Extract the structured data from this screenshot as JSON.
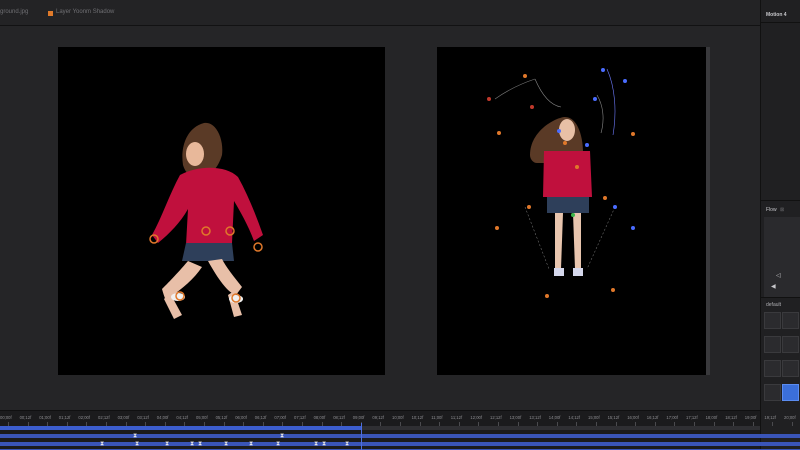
{
  "tabs": [
    {
      "label": "ground.jpg"
    },
    {
      "label": "Layer Yoonm Shadow"
    }
  ],
  "side_panel": {
    "title": "Motion 4",
    "flow_title": "Flow",
    "preset_label": "default"
  },
  "timeline": {
    "ruler": [
      "00;00f",
      "00;12f",
      "01;00f",
      "01;12f",
      "02;00f",
      "02;12f",
      "03;00f",
      "03;12f",
      "04;00f",
      "04;12f",
      "05;00f",
      "05;12f",
      "06;00f",
      "06;12f",
      "07;00f",
      "07;12f",
      "08;00f",
      "08;12f",
      "09;00f",
      "09;12f",
      "10;00f",
      "10;12f",
      "11;00f",
      "11;12f",
      "12;00f",
      "12;12f",
      "13;00f",
      "13;12f",
      "14;00f",
      "14;12f",
      "15;00f",
      "15;12f",
      "16;00f",
      "16;12f",
      "17;00f",
      "17;12f",
      "18;00f",
      "18;12f",
      "19;00f",
      "19;12f",
      "20;00f"
    ]
  },
  "colors": {
    "accent": "#3b6fd9",
    "tab_swatch": "#e07a2a",
    "handle_orange": "#e0782a",
    "handle_blue": "#4a6cff",
    "handle_red": "#c0392b"
  }
}
